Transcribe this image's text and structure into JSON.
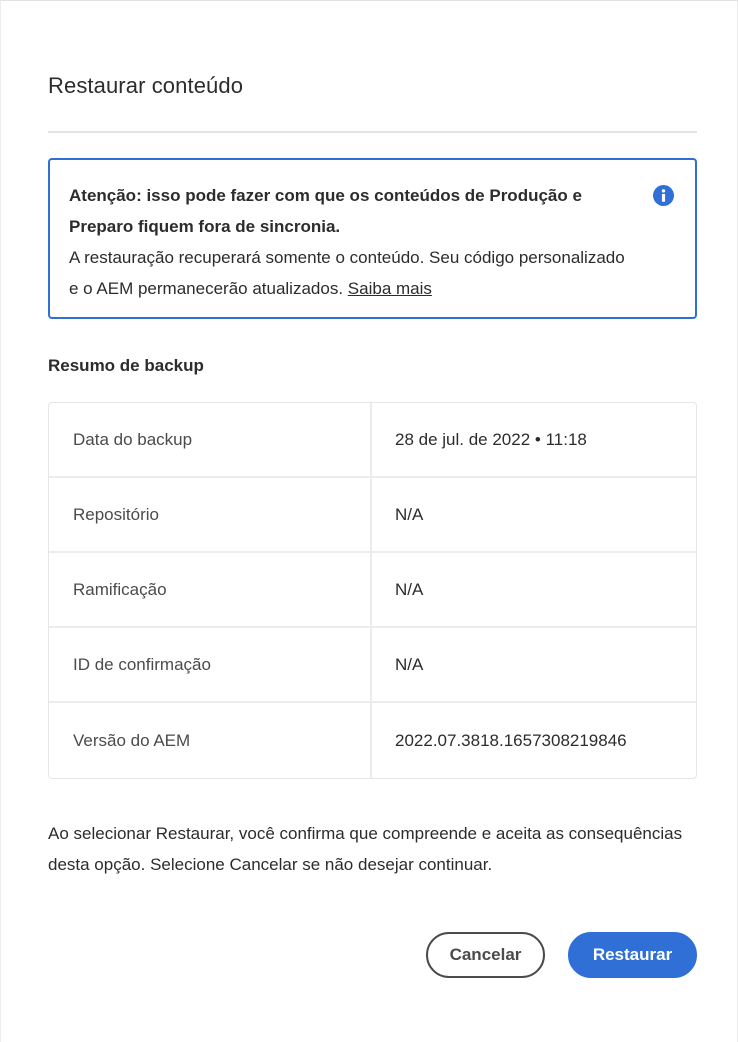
{
  "dialog": {
    "title": "Restaurar conteúdo"
  },
  "alert": {
    "heading": "Atenção: isso pode fazer com que os conteúdos de Produção e Preparo fiquem fora de sincronia.",
    "body": "A restauração recuperará somente o conteúdo. Seu código personalizado e o AEM permanecerão atualizados.",
    "link_label": "Saiba mais",
    "icon": "info-icon",
    "accent_color": "#2f6fd6"
  },
  "summary": {
    "heading": "Resumo de backup",
    "rows": [
      {
        "label": "Data do backup",
        "value": "28 de jul. de 2022 • 11:18"
      },
      {
        "label": "Repositório",
        "value": "N/A"
      },
      {
        "label": "Ramificação",
        "value": "N/A"
      },
      {
        "label": "ID de confirmação",
        "value": "N/A"
      },
      {
        "label": "Versão do AEM",
        "value": "2022.07.3818.1657308219846"
      }
    ]
  },
  "confirmation": {
    "text": "Ao selecionar Restaurar, você confirma que compreende e aceita as consequências desta opção. Selecione Cancelar se não desejar continuar."
  },
  "actions": {
    "cancel_label": "Cancelar",
    "restore_label": "Restaurar",
    "primary_color": "#2f6fd6"
  }
}
